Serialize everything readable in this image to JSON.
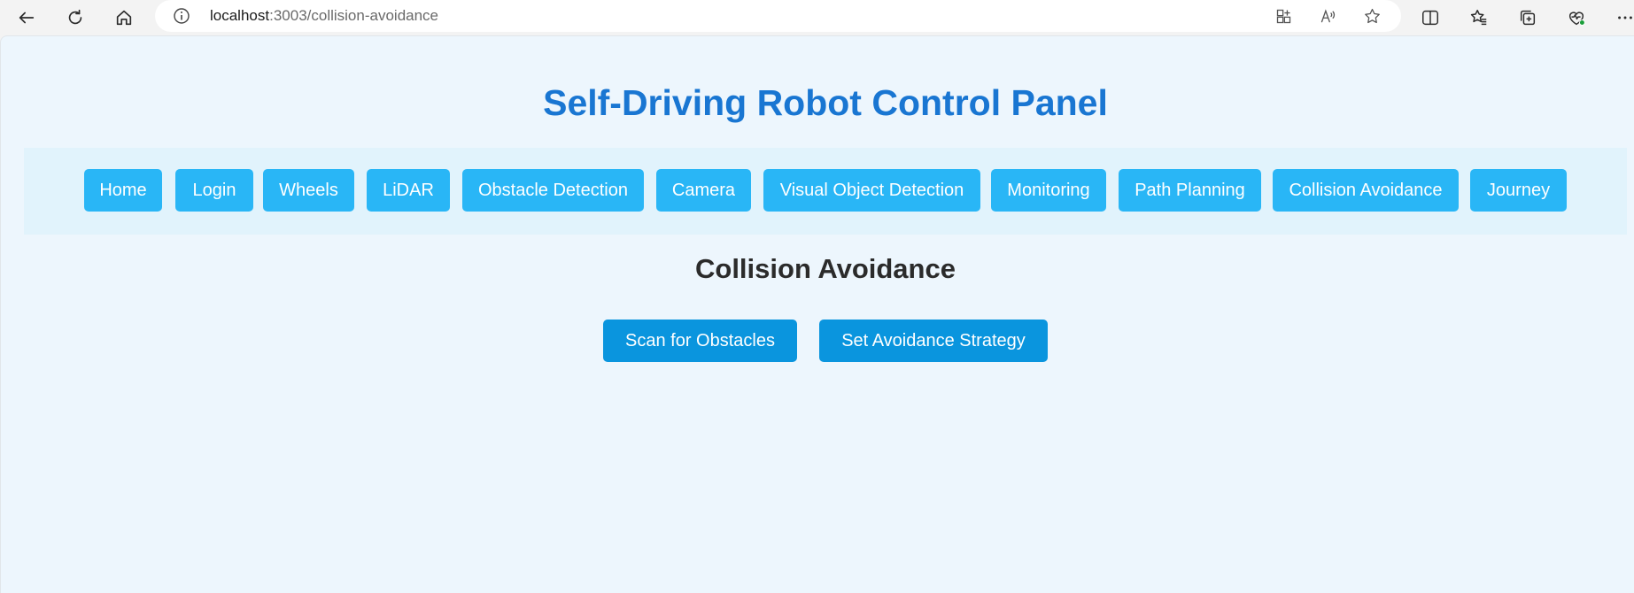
{
  "browser": {
    "url_host": "localhost",
    "url_path": ":3003/collision-avoidance"
  },
  "page": {
    "title": "Self-Driving Robot Control Panel",
    "nav": [
      {
        "label": "Home"
      },
      {
        "label": "Login"
      },
      {
        "label": "Wheels"
      },
      {
        "label": "LiDAR"
      },
      {
        "label": "Obstacle Detection"
      },
      {
        "label": "Camera"
      },
      {
        "label": "Visual Object Detection"
      },
      {
        "label": "Monitoring"
      },
      {
        "label": "Path Planning"
      },
      {
        "label": "Collision Avoidance"
      },
      {
        "label": "Journey"
      }
    ],
    "section_title": "Collision Avoidance",
    "actions": {
      "scan_label": "Scan for Obstacles",
      "strategy_label": "Set Avoidance Strategy"
    }
  },
  "colors": {
    "title": "#1976d2",
    "nav_button": "#29b6f6",
    "action_button": "#0a95de",
    "page_background": "#edf6fd",
    "navbar_background": "#e1f3fc"
  }
}
